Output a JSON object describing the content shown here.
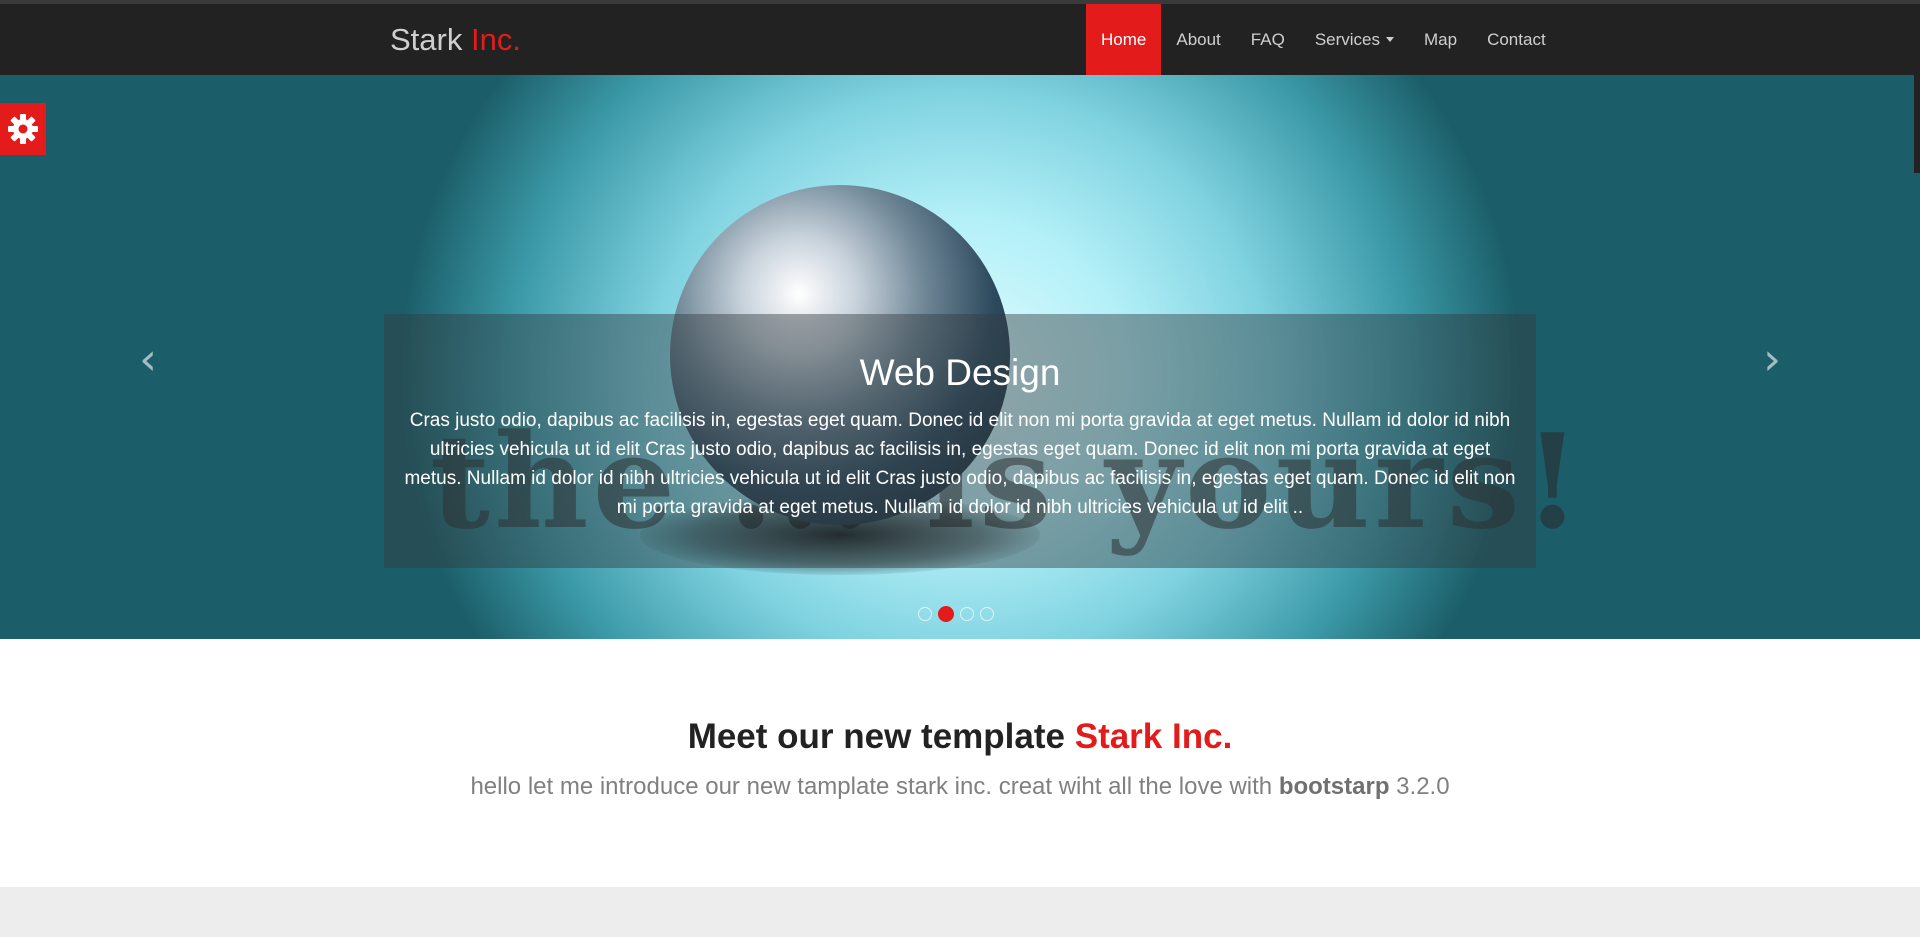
{
  "brand": {
    "name": "Stark",
    "accent": "Inc."
  },
  "nav": {
    "items": [
      {
        "label": "Home",
        "active": true
      },
      {
        "label": "About"
      },
      {
        "label": "FAQ"
      },
      {
        "label": "Services",
        "dropdown": true
      },
      {
        "label": "Map"
      },
      {
        "label": "Contact"
      }
    ]
  },
  "slider": {
    "slogan": "the ... is yours!",
    "caption_title": "Web Design",
    "caption_text": "Cras justo odio, dapibus ac facilisis in, egestas eget quam. Donec id elit non mi porta gravida at eget metus. Nullam id dolor id nibh ultricies vehicula ut id elit Cras justo odio, dapibus ac facilisis in, egestas eget quam. Donec id elit non mi porta gravida at eget metus. Nullam id dolor id nibh ultricies vehicula ut id elit Cras justo odio, dapibus ac facilisis in, egestas eget quam. Donec id elit non mi porta gravida at eget metus. Nullam id dolor id nibh ultricies vehicula ut id elit ..",
    "prev_icon": "‹",
    "next_icon": "›",
    "slide_count": 4,
    "active_slide": 2
  },
  "intro": {
    "title": "Meet our new template",
    "title_accent": "Stark Inc.",
    "subtitle": "hello let me introduce our new tamplate stark inc. creat wiht all the love with",
    "subtitle_bold": "bootstarp",
    "subtitle_end": "3.2.0"
  },
  "colors": {
    "accent": "#e31b1b",
    "navbar": "#222222"
  },
  "icons": {
    "settings": "gear-icon"
  }
}
